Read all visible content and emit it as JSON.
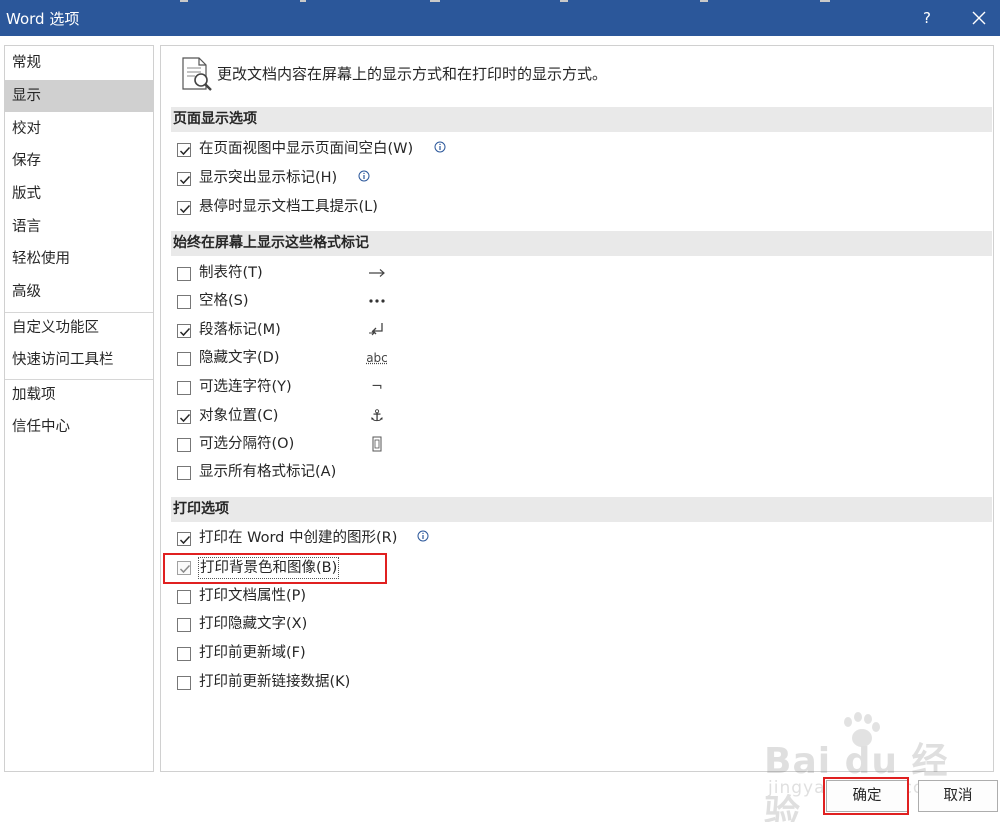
{
  "window": {
    "title": "Word 选项",
    "help": "?"
  },
  "sidebar": {
    "items": [
      {
        "label": "常规",
        "active": false
      },
      {
        "label": "显示",
        "active": true
      },
      {
        "label": "校对",
        "active": false
      },
      {
        "label": "保存",
        "active": false
      },
      {
        "label": "版式",
        "active": false
      },
      {
        "label": "语言",
        "active": false
      },
      {
        "label": "轻松使用",
        "active": false
      },
      {
        "label": "高级",
        "active": false
      },
      {
        "label": "自定义功能区",
        "active": false
      },
      {
        "label": "快速访问工具栏",
        "active": false
      },
      {
        "label": "加载项",
        "active": false
      },
      {
        "label": "信任中心",
        "active": false
      }
    ]
  },
  "main": {
    "headline": "更改文档内容在屏幕上的显示方式和在打印时的显示方式。",
    "sections": [
      {
        "title": "页面显示选项",
        "options": [
          {
            "label": "在页面视图中显示页面间空白(W)",
            "checked": true,
            "info": true
          },
          {
            "label": "显示突出显示标记(H)",
            "checked": true,
            "info": true
          },
          {
            "label": "悬停时显示文档工具提示(L)",
            "checked": true,
            "info": false
          }
        ]
      },
      {
        "title": "始终在屏幕上显示这些格式标记",
        "options": [
          {
            "label": "制表符(T)",
            "checked": false,
            "symbol": "tab-arrow-icon"
          },
          {
            "label": "空格(S)",
            "checked": false,
            "symbol": "space-dots-icon"
          },
          {
            "label": "段落标记(M)",
            "checked": true,
            "symbol": "paragraph-mark-icon"
          },
          {
            "label": "隐藏文字(D)",
            "checked": false,
            "symbol": "hidden-text-icon",
            "symbol_text": "abc"
          },
          {
            "label": "可选连字符(Y)",
            "checked": false,
            "symbol": "optional-hyphen-icon",
            "symbol_text": "¬"
          },
          {
            "label": "对象位置(C)",
            "checked": true,
            "symbol": "anchor-icon",
            "symbol_text": "⚓"
          },
          {
            "label": "可选分隔符(O)",
            "checked": false,
            "symbol": "optional-break-icon"
          },
          {
            "label": "显示所有格式标记(A)",
            "checked": false
          }
        ]
      },
      {
        "title": "打印选项",
        "options": [
          {
            "label": "打印在 Word 中创建的图形(R)",
            "checked": true,
            "info": true
          },
          {
            "label": "打印背景色和图像(B)",
            "checked": true,
            "highlighted": true,
            "disabled_look": true
          },
          {
            "label": "打印文档属性(P)",
            "checked": false
          },
          {
            "label": "打印隐藏文字(X)",
            "checked": false
          },
          {
            "label": "打印前更新域(F)",
            "checked": false
          },
          {
            "label": "打印前更新链接数据(K)",
            "checked": false
          }
        ]
      }
    ]
  },
  "footer": {
    "ok_label": "确定",
    "cancel_label": "取消"
  },
  "watermark": {
    "brand": "Bai du 经验",
    "url": "jingyan.baidu.com"
  },
  "colors": {
    "titlebar": "#2b579a",
    "highlight": "#e02020",
    "nav_active": "#d0d0d0",
    "section_bg": "#e9e9e9"
  }
}
